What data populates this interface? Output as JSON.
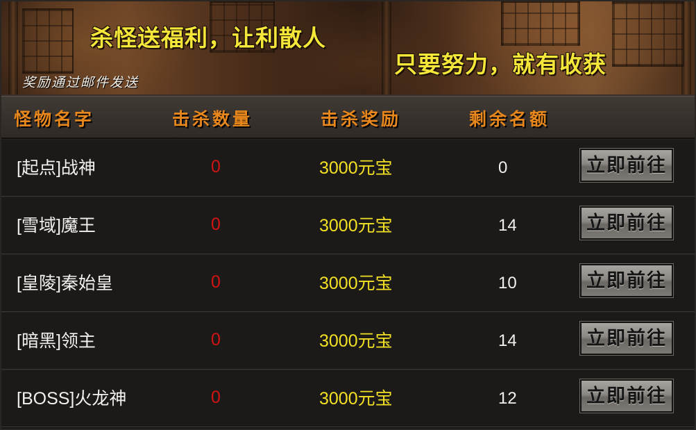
{
  "banner": {
    "title_left": "杀怪送福利，让利散人",
    "title_right": "只要努力，就有收获",
    "note": "奖励通过邮件发送"
  },
  "headers": {
    "name": "怪物名字",
    "kills": "击杀数量",
    "reward": "击杀奖励",
    "remaining": "剩余名额"
  },
  "rows": [
    {
      "name": "[起点]战神",
      "kills": "0",
      "reward": "3000元宝",
      "remaining": "0",
      "button": "立即前往"
    },
    {
      "name": "[雪域]魔王",
      "kills": "0",
      "reward": "3000元宝",
      "remaining": "14",
      "button": "立即前往"
    },
    {
      "name": "[皇陵]秦始皇",
      "kills": "0",
      "reward": "3000元宝",
      "remaining": "10",
      "button": "立即前往"
    },
    {
      "name": "[暗黑]领主",
      "kills": "0",
      "reward": "3000元宝",
      "remaining": "14",
      "button": "立即前往"
    },
    {
      "name": "[BOSS]火龙神",
      "kills": "0",
      "reward": "3000元宝",
      "remaining": "12",
      "button": "立即前往"
    }
  ],
  "colors": {
    "title": "#f5e63a",
    "header": "#e8871c",
    "kills": "#d01414",
    "reward": "#f2e024",
    "text": "#f2f0ec"
  }
}
